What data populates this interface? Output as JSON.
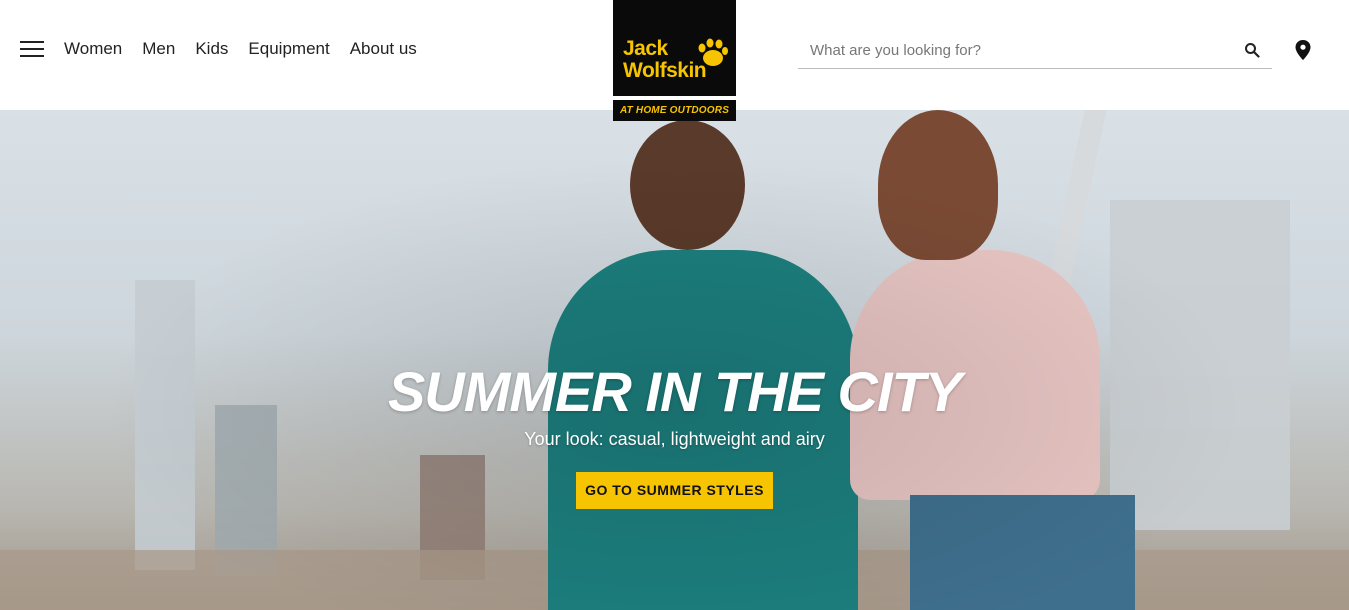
{
  "nav": {
    "items": [
      {
        "label": "Women"
      },
      {
        "label": "Men"
      },
      {
        "label": "Kids"
      },
      {
        "label": "Equipment"
      },
      {
        "label": "About us"
      }
    ]
  },
  "logo": {
    "line1": "Jack",
    "line2": "Wolfskin",
    "tagline": "AT HOME OUTDOORS"
  },
  "search": {
    "placeholder": "What are you looking for?",
    "value": ""
  },
  "icons": {
    "menu": "hamburger-icon",
    "search": "search-icon",
    "location": "location-pin-icon",
    "paw": "paw-icon"
  },
  "hero": {
    "title": "SUMMER IN THE CITY",
    "subtitle": "Your look: casual, lightweight and airy",
    "cta_label": "GO TO SUMMER STYLES"
  },
  "colors": {
    "brand_yellow": "#f6c400",
    "brand_black": "#0a0a0a"
  }
}
